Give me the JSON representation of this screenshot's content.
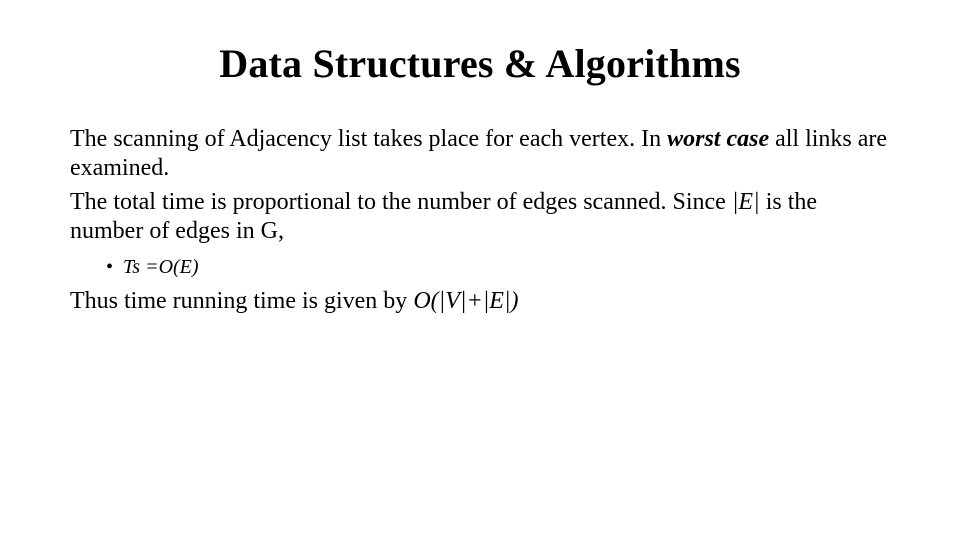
{
  "title": "Data Structures & Algorithms",
  "p1_a": "The scanning of Adjacency list takes place for each vertex. In ",
  "p1_b": "worst case",
  "p1_c": " all links are examined.",
  "p2_a": "The total time is proportional to the number of edges scanned. Since ",
  "p2_b": "|E|",
  "p2_c": " is the number of edges in G,",
  "bullet_dot": "•",
  "bullet": "Ts =O(E)",
  "p3_a": "Thus time running time is given by ",
  "p3_b": "O(",
  "p3_c": "|V|+|E|",
  "p3_d": ")"
}
